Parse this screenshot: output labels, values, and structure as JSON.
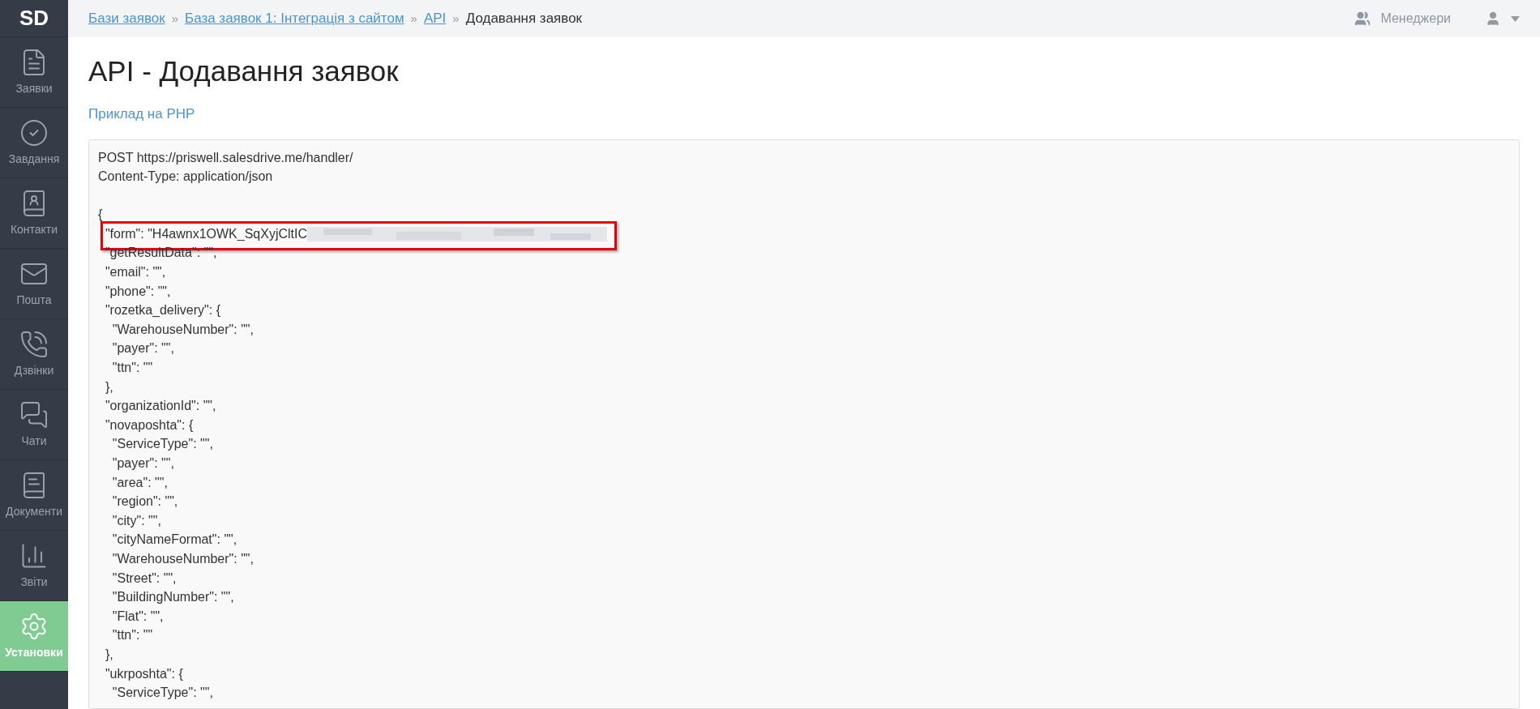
{
  "sidebar": {
    "logo": "SD",
    "items": [
      {
        "kind": "requests",
        "label": "Заявки",
        "selected": false
      },
      {
        "kind": "tasks",
        "label": "Завдання",
        "selected": false
      },
      {
        "kind": "contacts",
        "label": "Контакти",
        "selected": false
      },
      {
        "kind": "mail",
        "label": "Пошта",
        "selected": false
      },
      {
        "kind": "calls",
        "label": "Дзвінки",
        "selected": false
      },
      {
        "kind": "chats",
        "label": "Чати",
        "selected": false
      },
      {
        "kind": "documents",
        "label": "Документи",
        "selected": false
      },
      {
        "kind": "reports",
        "label": "Звіти",
        "selected": false
      },
      {
        "kind": "settings",
        "label": "Установки",
        "selected": true
      }
    ]
  },
  "breadcrumbs": [
    {
      "label": "Бази заявок",
      "link": true
    },
    {
      "separator": "»",
      "label": "База заявок 1: Інтеграція з сайтом",
      "link": true
    },
    {
      "separator": "»",
      "label": "API",
      "link": true
    },
    {
      "separator": "»",
      "label": "Додавання заявок",
      "link": false
    }
  ],
  "topbar": {
    "managers": "Менеджери"
  },
  "title": "API - Додавання заявок",
  "example_link": "Приклад на PHP",
  "code": {
    "lines": [
      {
        "text": "POST https://priswell.salesdrive.me/handler/"
      },
      {
        "text": "Content-Type: application/json",
        "gap_after": true
      },
      {
        "text": "{"
      },
      {
        "text": "  \"form\": \"H4awnx1OWK_SqXyjCltIC",
        "redacted": true,
        "highlighted": true
      },
      {
        "text": "  \"getResultData\": \"\","
      },
      {
        "text": "  \"email\": \"\","
      },
      {
        "text": "  \"phone\": \"\","
      },
      {
        "text": "  \"rozetka_delivery\": {"
      },
      {
        "text": "    \"WarehouseNumber\": \"\","
      },
      {
        "text": "    \"payer\": \"\","
      },
      {
        "text": "    \"ttn\": \"\""
      },
      {
        "text": "  },"
      },
      {
        "text": "  \"organizationId\": \"\","
      },
      {
        "text": "  \"novaposhta\": {"
      },
      {
        "text": "    \"ServiceType\": \"\","
      },
      {
        "text": "    \"payer\": \"\","
      },
      {
        "text": "    \"area\": \"\","
      },
      {
        "text": "    \"region\": \"\","
      },
      {
        "text": "    \"city\": \"\","
      },
      {
        "text": "    \"cityNameFormat\": \"\","
      },
      {
        "text": "    \"WarehouseNumber\": \"\","
      },
      {
        "text": "    \"Street\": \"\","
      },
      {
        "text": "    \"BuildingNumber\": \"\","
      },
      {
        "text": "    \"Flat\": \"\","
      },
      {
        "text": "    \"ttn\": \"\""
      },
      {
        "text": "  },"
      },
      {
        "text": "  \"ukrposhta\": {"
      },
      {
        "text": "    \"ServiceType\": \"\","
      }
    ]
  }
}
